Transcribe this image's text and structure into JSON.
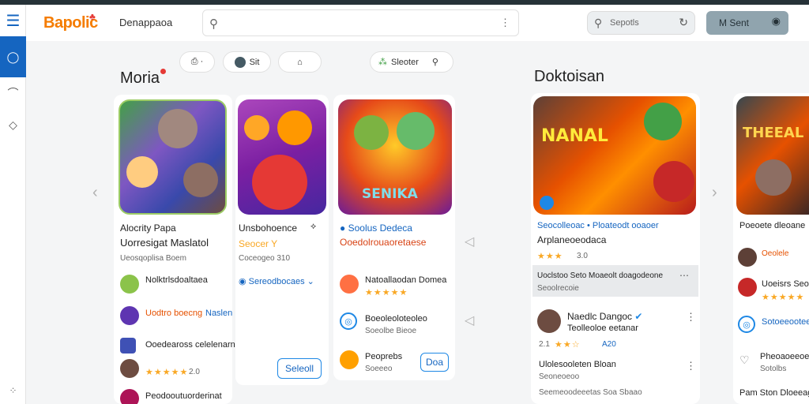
{
  "header": {
    "logo": "Bapolic",
    "developer_label": "Denappaoa",
    "search_placeholder": "",
    "search2_label": "Sepotls",
    "send_label": "M Sent"
  },
  "toolbar": {
    "pill3_label": "Sleoter",
    "pill2_label": "Sit"
  },
  "sections": {
    "left_title": "Moria",
    "right_title": "Doktoisan"
  },
  "cards": {
    "c1": {
      "title": "Alocrity Papa",
      "subtitle": "Uorresigat Maslatol",
      "meta": "Ueosqoplisa Boem",
      "row1": "Nolktrlsdoaltaea",
      "row2_label": "Uodtro boecng",
      "row2_link": "Naslen",
      "row3": "Ooedeaross celelenarnatie",
      "rating": "2.0",
      "bottom": "Peodooutuorderinat"
    },
    "c2": {
      "title": "Unsbohoence",
      "subtitle": "Seocer Y",
      "meta": "Coceogeo 310",
      "pill": "Sereodbocaes",
      "button": "Seleoll"
    },
    "c3": {
      "art_title": "SENIKA",
      "title": "Soolus Dedeca",
      "subtitle": "Ooedolrouaoretaese",
      "row1": "Natoallaodan Domea",
      "row2": "Boeoleoloteoleo",
      "row2_sub": "Soeolbe Bieoe",
      "row3": "Peoprebs",
      "row3_sub": "Soeeeo",
      "button": "Doa"
    },
    "c4": {
      "art_title": "NANAL",
      "title": "Seocolleoac • Ploateodt ooaoer",
      "subtitle": "Arplaneoeodaca",
      "rating": "3.0",
      "note": "Uoclstoo Seto Moaeolt doagodeone",
      "note_sub": "Seoolrecoie",
      "dev_title": "Naedlc Dangoc",
      "dev_sub": "Teolleoloe eetanar",
      "dev_meta": "2.1",
      "dev_meta_link": "A20",
      "row2": "Ulolesooleten Bloan",
      "row2_sub": "Seoneoeoo",
      "row3": "Seemeoodeeetas Soa Sbaao"
    },
    "c5": {
      "art_title": "THEEAL",
      "title": "Poeoete dleoane",
      "row1": "Oeolele",
      "row2": "Uoeisrs Seo",
      "row3": "Sotoeeooteeo",
      "row4": "Pheoaoeeoe",
      "row4_sub": "Sotolbs",
      "bottom": "Pam Ston Dloeeag"
    }
  },
  "colors": {
    "accent": "#1565c0",
    "logo_orange": "#f57c00",
    "stars": "#f9a825"
  }
}
